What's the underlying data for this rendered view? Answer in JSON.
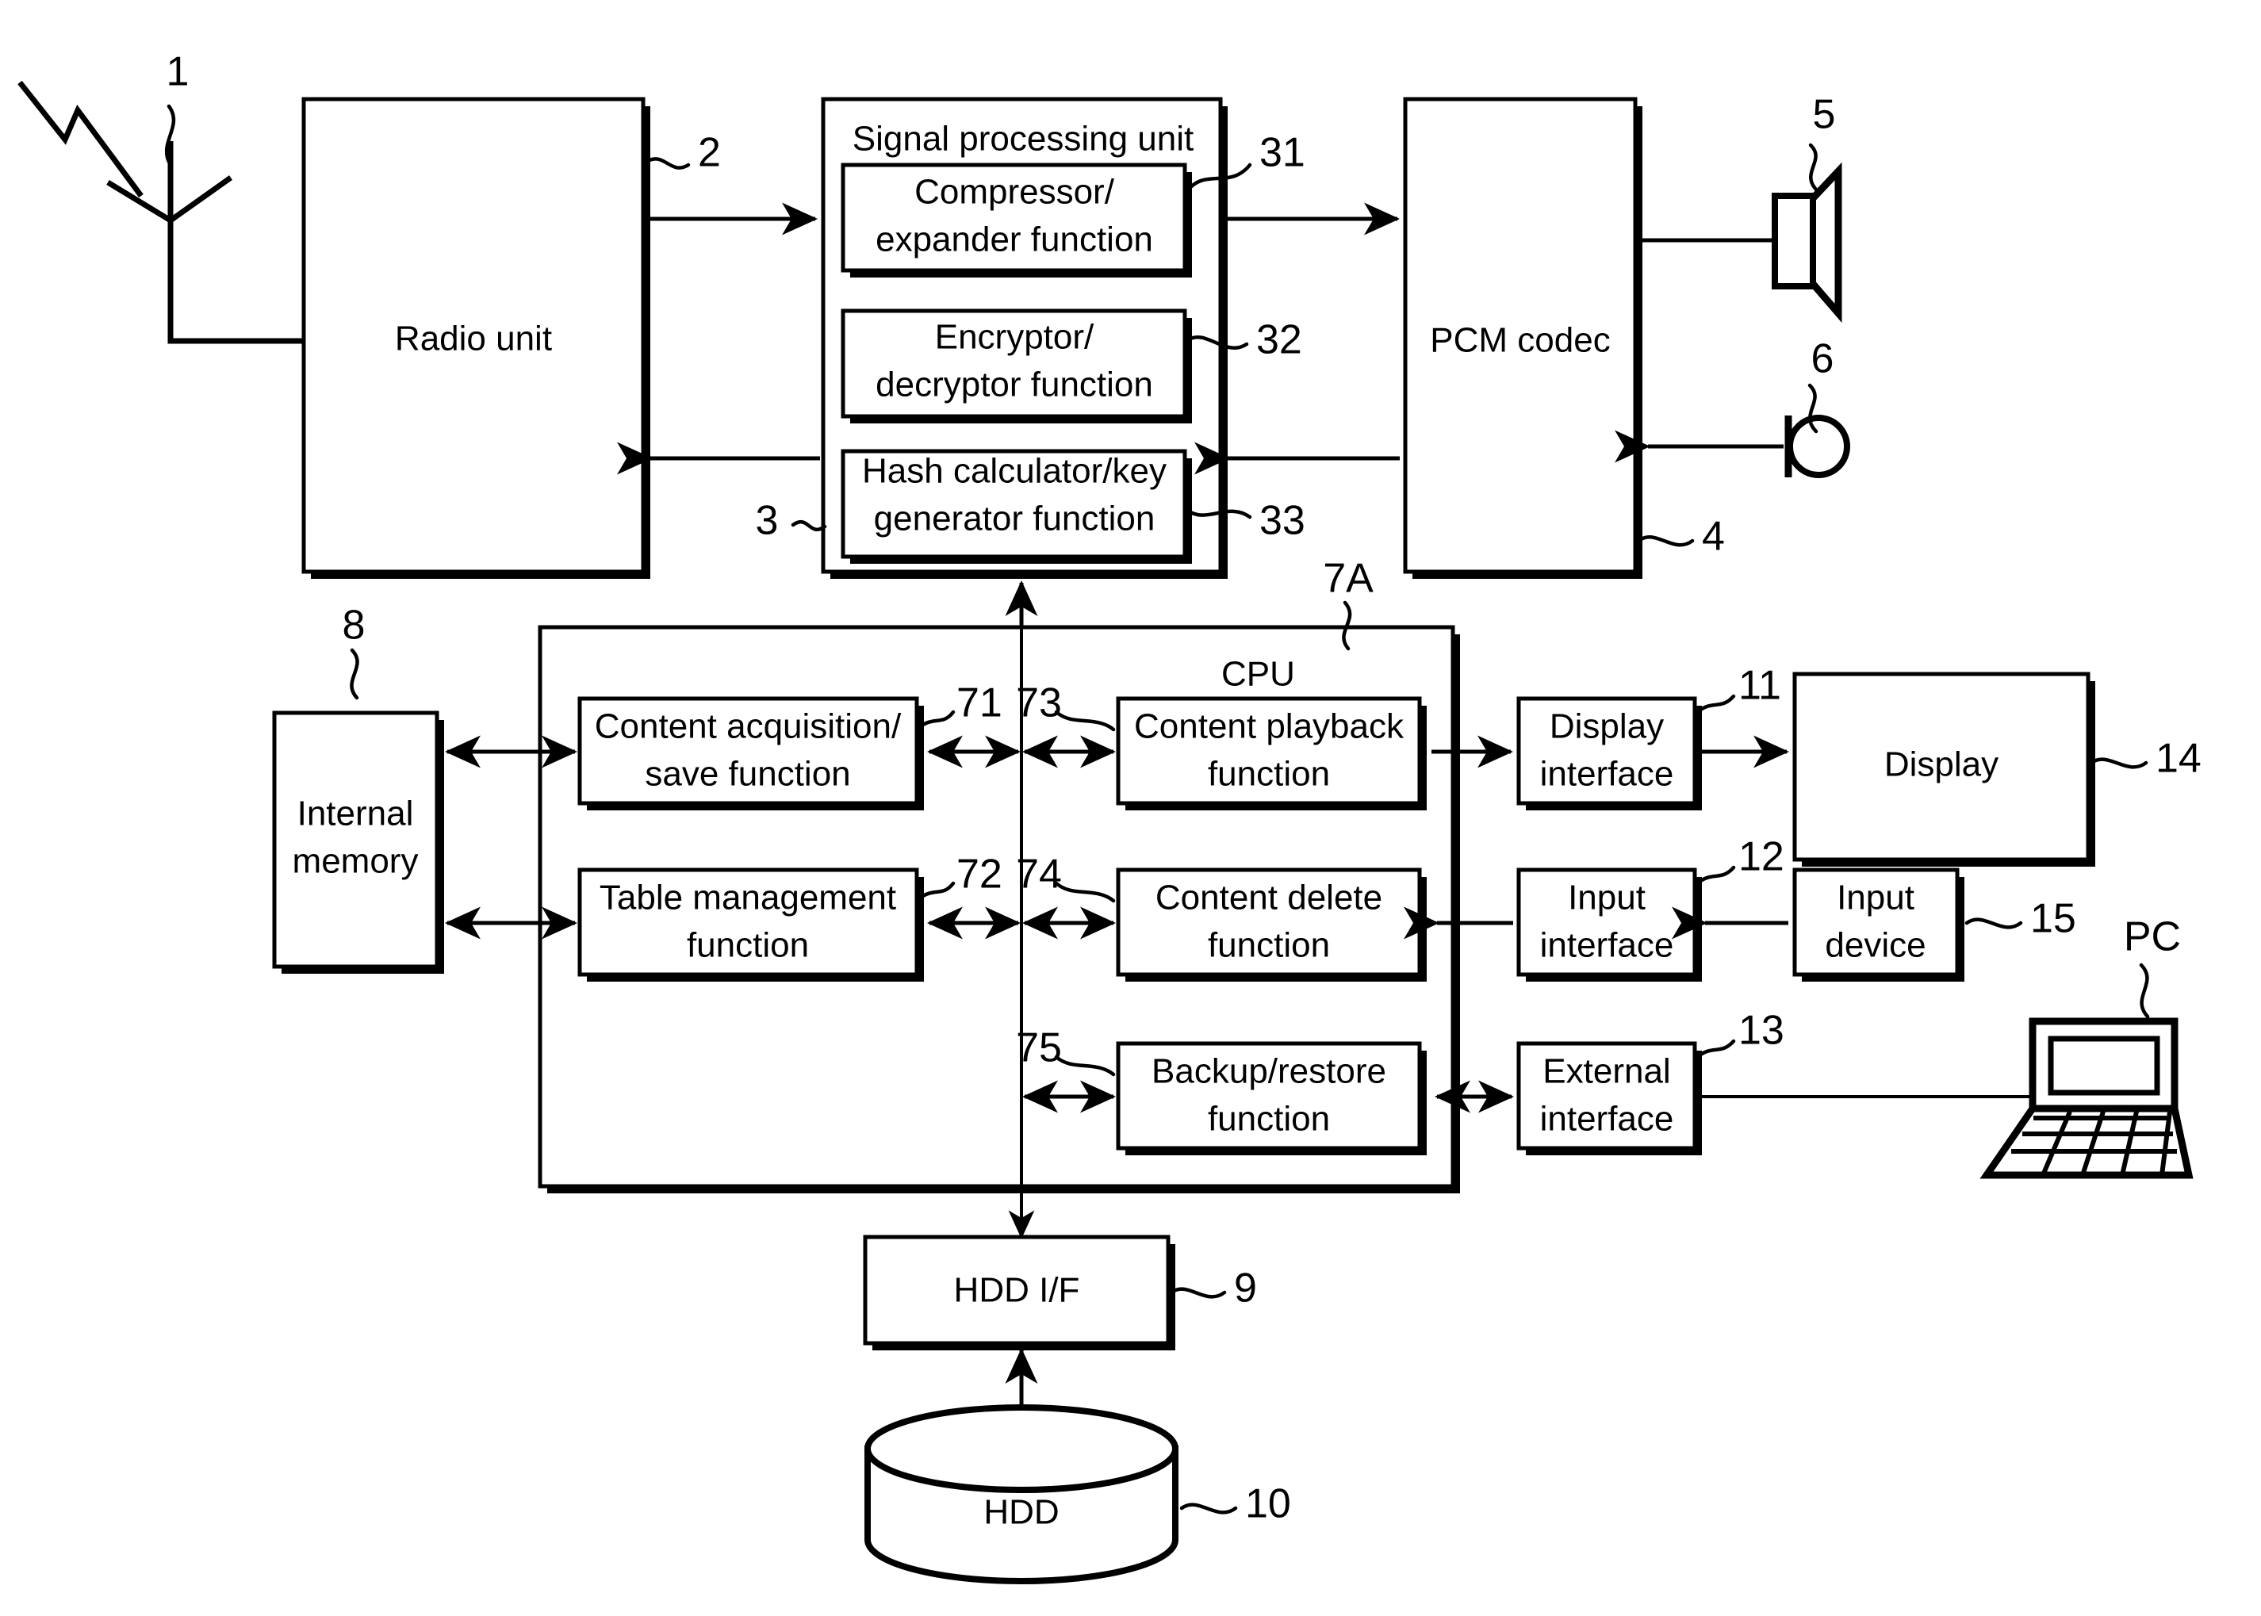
{
  "figure": {
    "type": "patent-block-diagram",
    "title": ""
  },
  "blocks": {
    "radio_unit": {
      "label": "Radio unit",
      "ref": "2"
    },
    "signal_processing_unit": {
      "label": "Signal processing unit",
      "ref": "3"
    },
    "compressor_expander": {
      "label_line1": "Compressor/",
      "label_line2": "expander function",
      "ref": "31"
    },
    "encryptor_decryptor": {
      "label_line1": "Encryptor/",
      "label_line2": "decryptor function",
      "ref": "32"
    },
    "hash_key_generator": {
      "label_line1": "Hash calculator/key",
      "label_line2": "generator function",
      "ref": "33"
    },
    "pcm_codec": {
      "label": "PCM codec",
      "ref": "4"
    },
    "cpu": {
      "label": "CPU",
      "ref": "7A"
    },
    "content_acquisition_save": {
      "label_line1": "Content acquisition/",
      "label_line2": "save function",
      "ref": "71"
    },
    "table_management": {
      "label_line1": "Table management",
      "label_line2": "function",
      "ref": "72"
    },
    "content_playback": {
      "label_line1": "Content playback",
      "label_line2": "function",
      "ref": "73"
    },
    "content_delete": {
      "label_line1": "Content delete",
      "label_line2": "function",
      "ref": "74"
    },
    "backup_restore": {
      "label_line1": "Backup/restore",
      "label_line2": "function",
      "ref": "75"
    },
    "internal_memory": {
      "label_line1": "Internal",
      "label_line2": "memory",
      "ref": "8"
    },
    "display_interface": {
      "label_line1": "Display",
      "label_line2": "interface",
      "ref": "11"
    },
    "input_interface": {
      "label_line1": "Input",
      "label_line2": "interface",
      "ref": "12"
    },
    "external_interface": {
      "label_line1": "External",
      "label_line2": "interface",
      "ref": "13"
    },
    "display": {
      "label": "Display",
      "ref": "14"
    },
    "input_device": {
      "label_line1": "Input",
      "label_line2": "device",
      "ref": "15"
    },
    "hdd_if": {
      "label": "HDD I/F",
      "ref": "9"
    },
    "hdd": {
      "label": "HDD",
      "ref": "10"
    }
  },
  "icons": {
    "antenna": {
      "ref": "1",
      "name": "antenna-icon"
    },
    "speaker": {
      "ref": "5",
      "name": "speaker-icon"
    },
    "microphone": {
      "ref": "6",
      "name": "microphone-icon"
    },
    "laptop": {
      "ref": "PC",
      "name": "laptop-pc-icon"
    }
  },
  "colors": {
    "line": "#000000",
    "fill": "#ffffff"
  }
}
